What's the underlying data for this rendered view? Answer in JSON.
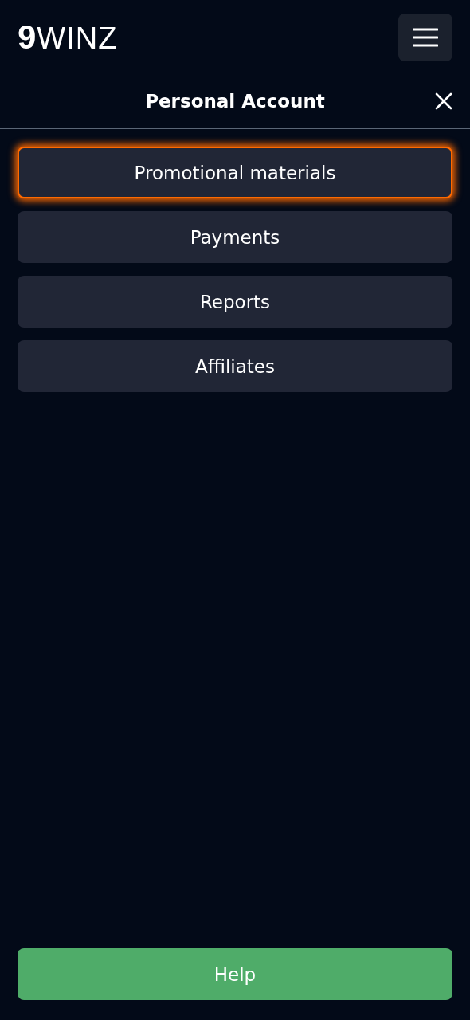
{
  "header": {
    "logo": "**9**WINZ"
  },
  "panel": {
    "title": "Personal Account"
  },
  "menu": [
    {
      "label": "Promotional materials",
      "selected": true
    },
    {
      "label": "Payments",
      "selected": false
    },
    {
      "label": "Reports",
      "selected": false
    },
    {
      "label": "Affiliates",
      "selected": false
    }
  ],
  "help_button": "Help"
}
